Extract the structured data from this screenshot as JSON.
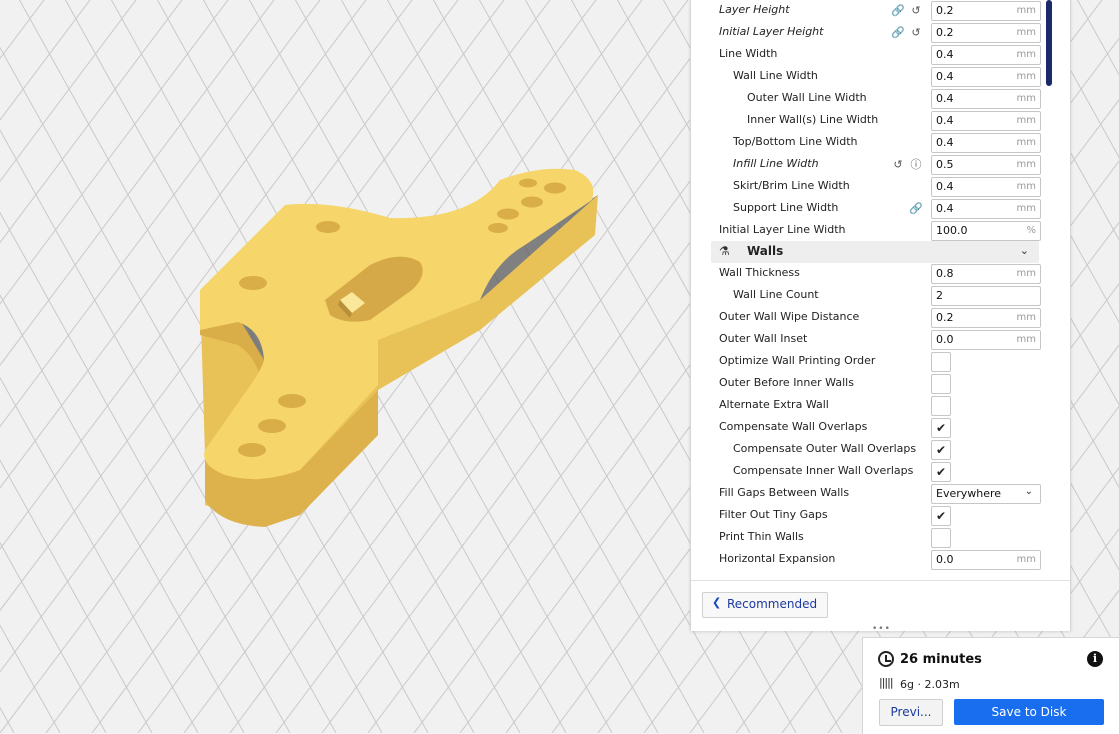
{
  "settings": {
    "rows": [
      {
        "label": "Layer Height",
        "value": "0.2",
        "unit": "mm",
        "italic": true,
        "icons": [
          "link-icon",
          "reset-icon"
        ]
      },
      {
        "label": "Initial Layer Height",
        "value": "0.2",
        "unit": "mm",
        "italic": true,
        "icons": [
          "link-icon",
          "reset-icon"
        ]
      },
      {
        "label": "Line Width",
        "value": "0.4",
        "unit": "mm"
      },
      {
        "label": "Wall Line Width",
        "value": "0.4",
        "unit": "mm"
      },
      {
        "label": "Outer Wall Line Width",
        "value": "0.4",
        "unit": "mm"
      },
      {
        "label": "Inner Wall(s) Line Width",
        "value": "0.4",
        "unit": "mm"
      },
      {
        "label": "Top/Bottom Line Width",
        "value": "0.4",
        "unit": "mm"
      },
      {
        "label": "Infill Line Width",
        "value": "0.5",
        "unit": "mm",
        "italic": true,
        "icons": [
          "reset-icon",
          "info-icon"
        ]
      },
      {
        "label": "Skirt/Brim Line Width",
        "value": "0.4",
        "unit": "mm"
      },
      {
        "label": "Support Line Width",
        "value": "0.4",
        "unit": "mm",
        "icons": [
          "link-icon"
        ]
      },
      {
        "label": "Initial Layer Line Width",
        "value": "100.0",
        "unit": "%"
      }
    ],
    "walls_section": {
      "title": "Walls",
      "icon": "walls-icon"
    },
    "wall_rows": [
      {
        "label": "Wall Thickness",
        "value": "0.8",
        "unit": "mm"
      },
      {
        "label": "Wall Line Count",
        "value": "2",
        "unit": ""
      },
      {
        "label": "Outer Wall Wipe Distance",
        "value": "0.2",
        "unit": "mm"
      },
      {
        "label": "Outer Wall Inset",
        "value": "0.0",
        "unit": "mm"
      },
      {
        "label": "Optimize Wall Printing Order",
        "checked": false
      },
      {
        "label": "Outer Before Inner Walls",
        "checked": false
      },
      {
        "label": "Alternate Extra Wall",
        "checked": false
      },
      {
        "label": "Compensate Wall Overlaps",
        "checked": true
      },
      {
        "label": "Compensate Outer Wall Overlaps",
        "checked": true
      },
      {
        "label": "Compensate Inner Wall Overlaps",
        "checked": true
      },
      {
        "label": "Fill Gaps Between Walls",
        "select": "Everywhere"
      },
      {
        "label": "Filter Out Tiny Gaps",
        "checked": true
      },
      {
        "label": "Print Thin Walls",
        "checked": false
      },
      {
        "label": "Horizontal Expansion",
        "value": "0.0",
        "unit": "mm"
      }
    ],
    "recommended_label": "Recommended"
  },
  "estimate": {
    "time": "26 minutes",
    "material": "6g · 2.03m",
    "preview_label": "Previ...",
    "save_label": "Save to Disk"
  },
  "colors": {
    "accent": "#196ef0",
    "model": "#f6d56b",
    "model_side": "#e9c257",
    "scrollbar": "#1b2a6b"
  }
}
